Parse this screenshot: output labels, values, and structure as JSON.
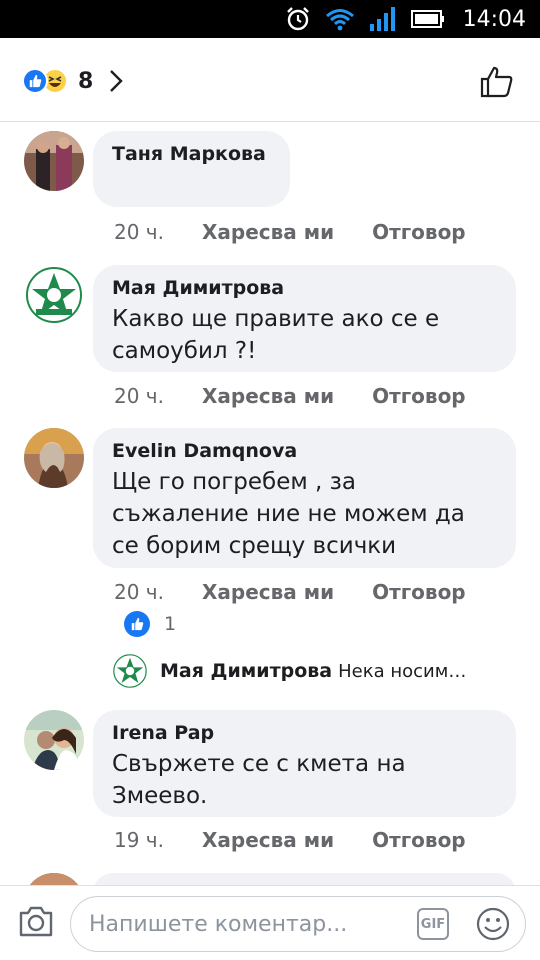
{
  "status_bar": {
    "time": "14:04"
  },
  "header": {
    "reaction_count": "8",
    "icons": [
      "like-reaction",
      "haha-reaction",
      "chevron-right",
      "thumbs-up"
    ]
  },
  "comments": [
    {
      "author": "Таня Маркова",
      "text": "",
      "time": "20 ч.",
      "like_label": "Харесва ми",
      "reply_label": "Отговор"
    },
    {
      "author": "Мая Димитрова",
      "text": "Какво ще правите ако се е самоубил ?!",
      "time": "20 ч.",
      "like_label": "Харесва ми",
      "reply_label": "Отговор"
    },
    {
      "author": "Evelin Damqnova",
      "text": "Ще го погребем , за съжаление ние не можем да се борим срещу всички",
      "time": "20 ч.",
      "like_label": "Харесва ми",
      "reply_label": "Отговор",
      "likes": "1"
    },
    {
      "author": "Irena Pap",
      "text": "Свържете се с кмета на Змеево.",
      "time": "19 ч.",
      "like_label": "Харесва ми",
      "reply_label": "Отговор"
    }
  ],
  "reply_preview": {
    "author": "Мая Димитрова",
    "text": "Нека носим…"
  },
  "composer": {
    "placeholder": "Напишете коментар...",
    "gif_label": "GIF"
  },
  "colors": {
    "accent": "#1877f2",
    "bubble": "#f0f2f5",
    "meta": "#65676b"
  }
}
